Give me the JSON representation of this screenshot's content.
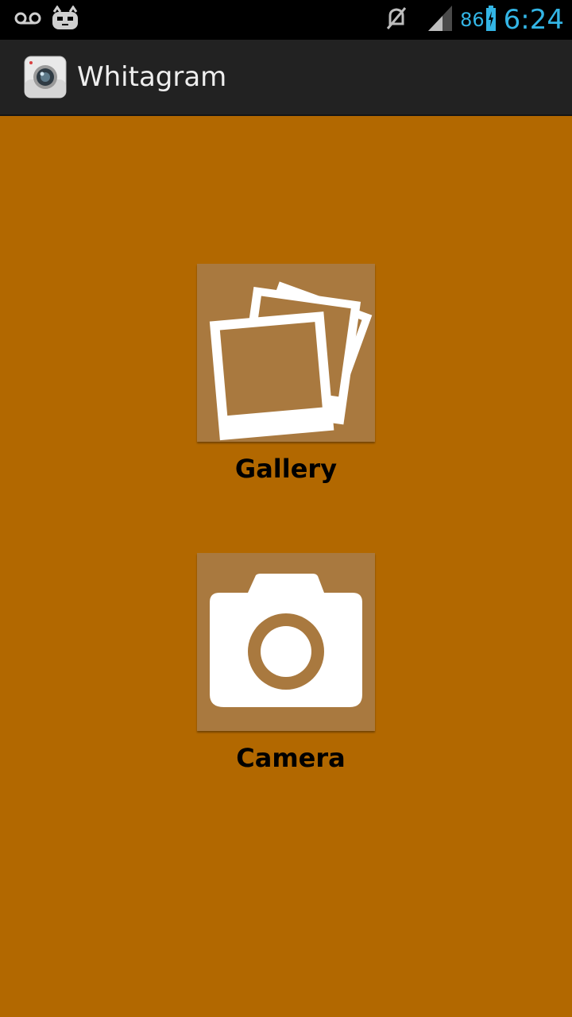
{
  "status_bar": {
    "battery_percent": "86",
    "time": "6:24",
    "icons": [
      "voicemail-icon",
      "cyanogenmod-icon",
      "muted-icon",
      "signal-icon",
      "battery-icon"
    ]
  },
  "action_bar": {
    "title": "Whitagram",
    "icon": "app-camera-icon"
  },
  "main": {
    "options": [
      {
        "label": "Gallery",
        "icon": "gallery-icon"
      },
      {
        "label": "Camera",
        "icon": "camera-icon"
      }
    ]
  },
  "colors": {
    "background": "#b26800",
    "tile": "#a9793f",
    "status_bar": "#000000",
    "action_bar": "#222222",
    "accent": "#33b5e5"
  }
}
